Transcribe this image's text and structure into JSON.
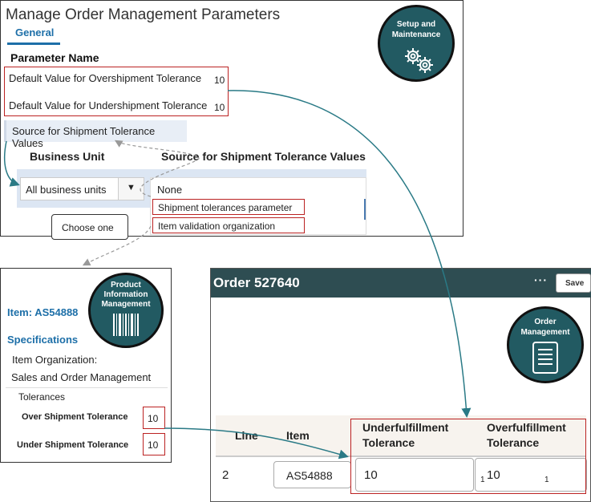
{
  "setup_panel": {
    "title": "Manage Order Management Parameters",
    "tab": "General",
    "parameter_header": "Parameter Name",
    "parameters": [
      {
        "label": "Default Value for Overshipment Tolerance",
        "value": "10"
      },
      {
        "label": "Default Value for Undershipment Tolerance",
        "value": "10"
      }
    ],
    "source_param": "Source for Shipment Tolerance Values",
    "bu_header": "Business Unit",
    "source_header": "Source for Shipment Tolerance Values",
    "bu_value": "All business units",
    "dropdown_options": [
      "None",
      "Shipment tolerances parameter",
      "Item validation organization"
    ],
    "callout": "Choose one"
  },
  "badges": {
    "setup": [
      "Setup and",
      "Maintenance"
    ],
    "pim": [
      "Product",
      "Information",
      "Management"
    ],
    "om": [
      "Order",
      "Management"
    ]
  },
  "pim_panel": {
    "item": "Item: AS54888",
    "specifications": "Specifications",
    "item_org": "Item Organization:",
    "org_value": "Sales and Order Management",
    "tolerances": "Tolerances",
    "over_label": "Over Shipment Tolerance",
    "over_value": "10",
    "under_label": "Under Shipment Tolerance",
    "under_value": "10"
  },
  "order_panel": {
    "title": "Order 527640",
    "more": "···",
    "save": "Save",
    "columns": {
      "line": "Line",
      "item": "Item",
      "under": "Underfulfillment Tolerance",
      "over": "Overfulfillment Tolerance"
    },
    "row": {
      "line": "2",
      "item": "AS54888",
      "under": "10",
      "under_sub": "1",
      "over": "10",
      "over_sub": "1"
    }
  },
  "colors": {
    "badge": "#225a62",
    "link_blue": "#1d6fa8",
    "highlight_red": "#b22222",
    "header_dark": "#2e4d52",
    "connector_teal": "#2a7a86"
  }
}
